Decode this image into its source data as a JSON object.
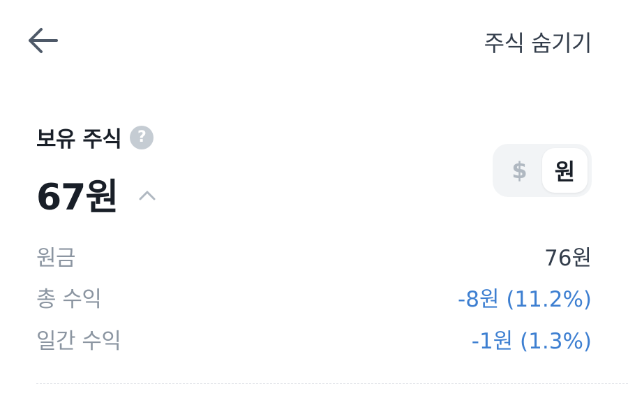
{
  "header": {
    "back_icon": "arrow-left-icon",
    "hide_stock_label": "주식 숨기기"
  },
  "holdings": {
    "title": "보유 주식",
    "help_icon": "question-circle-icon",
    "help_glyph": "?",
    "amount": "67원",
    "collapse_icon": "chevron-up-icon"
  },
  "currency_toggle": {
    "options": [
      "$",
      "원"
    ],
    "selected": "원"
  },
  "details": [
    {
      "label": "원금",
      "value": "76원"
    },
    {
      "label": "총 수익",
      "value": "-8원 (11.2%)"
    },
    {
      "label": "일간 수익",
      "value": "-1원 (1.3%)"
    }
  ],
  "colors": {
    "text_primary": "#191f28",
    "text_secondary": "#8b95a1",
    "loss_blue": "#3d7fd1",
    "toggle_bg": "#f2f4f6"
  }
}
